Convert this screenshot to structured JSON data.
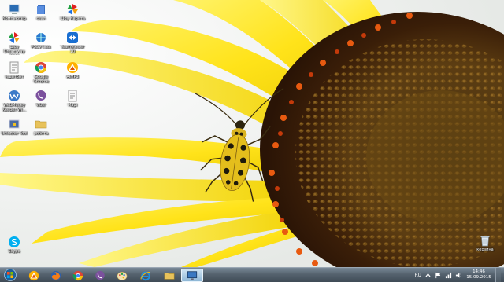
{
  "desktop_icons": [
    {
      "label": "Компьютер",
      "icon": "computer-icon"
    },
    {
      "label": "сеал",
      "icon": "file-icon"
    },
    {
      "label": "Шоу Карета",
      "icon": "pinwheel-icon"
    },
    {
      "label": "Шоу Dreamway 2016",
      "icon": "pinwheel-icon"
    },
    {
      "label": "PSSVT.sss",
      "icon": "globe-icon"
    },
    {
      "label": "TeamViewer 10",
      "icon": "teamviewer-icon"
    },
    {
      "label": "мщятбот",
      "icon": "document-icon"
    },
    {
      "label": "Google Chrome",
      "icon": "chrome-icon"
    },
    {
      "label": "АІМР3",
      "icon": "aimp-icon"
    },
    {
      "label": "WebMoney Keeper Wi...",
      "icon": "webmoney-icon"
    },
    {
      "label": "Viber",
      "icon": "viber-icon"
    },
    {
      "label": "Марі",
      "icon": "document-icon"
    },
    {
      "label": "Unlocker Tool",
      "icon": "unlocker-icon"
    },
    {
      "label": "робота",
      "icon": "folder-icon"
    },
    {
      "label": "Skype",
      "icon": "skype-icon"
    },
    {
      "label": "корзина",
      "icon": "recycle-bin-icon"
    }
  ],
  "taskbar": {
    "pinned": [
      {
        "name": "aimp",
        "icon": "aimp-icon",
        "active": false
      },
      {
        "name": "firefox",
        "icon": "firefox-icon",
        "active": false
      },
      {
        "name": "chrome",
        "icon": "chrome-icon",
        "active": false
      },
      {
        "name": "viber",
        "icon": "viber-icon",
        "active": false
      },
      {
        "name": "paint",
        "icon": "paint-icon",
        "active": false
      },
      {
        "name": "internet-explorer",
        "icon": "ie-icon",
        "active": false
      },
      {
        "name": "explorer",
        "icon": "folder-icon",
        "active": false
      },
      {
        "name": "remote-desktop",
        "icon": "monitor-icon",
        "active": true
      }
    ],
    "tray": {
      "language": "RU",
      "time": "14:46",
      "date": "15.09.2015"
    }
  }
}
